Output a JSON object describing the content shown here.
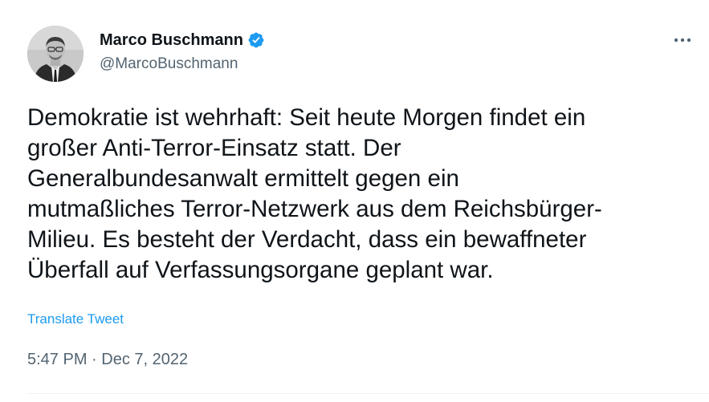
{
  "author": {
    "display_name": "Marco Buschmann",
    "handle": "@MarcoBuschmann",
    "verified": true,
    "verified_color": "#1d9bf0"
  },
  "tweet": {
    "text": "Demokratie ist wehrhaft: Seit heute Morgen findet ein\ngroßer Anti-Terror-Einsatz statt. Der\nGeneralbundesanwalt ermittelt gegen ein\nmutmaßliches Terror-Netzwerk aus dem Reichsbürger-\nMilieu. Es besteht der Verdacht, dass ein bewaffneter\nÜberfall auf Verfassungsorgane geplant war.",
    "translate_label": "Translate Tweet",
    "time": "5:47 PM",
    "separator": " · ",
    "date": "Dec 7, 2022"
  },
  "icons": {
    "more": "more-horizontal-icon",
    "verified": "verified-badge-icon"
  },
  "colors": {
    "link": "#1d9bf0",
    "secondary_text": "#536471",
    "primary_text": "#0f1419"
  }
}
